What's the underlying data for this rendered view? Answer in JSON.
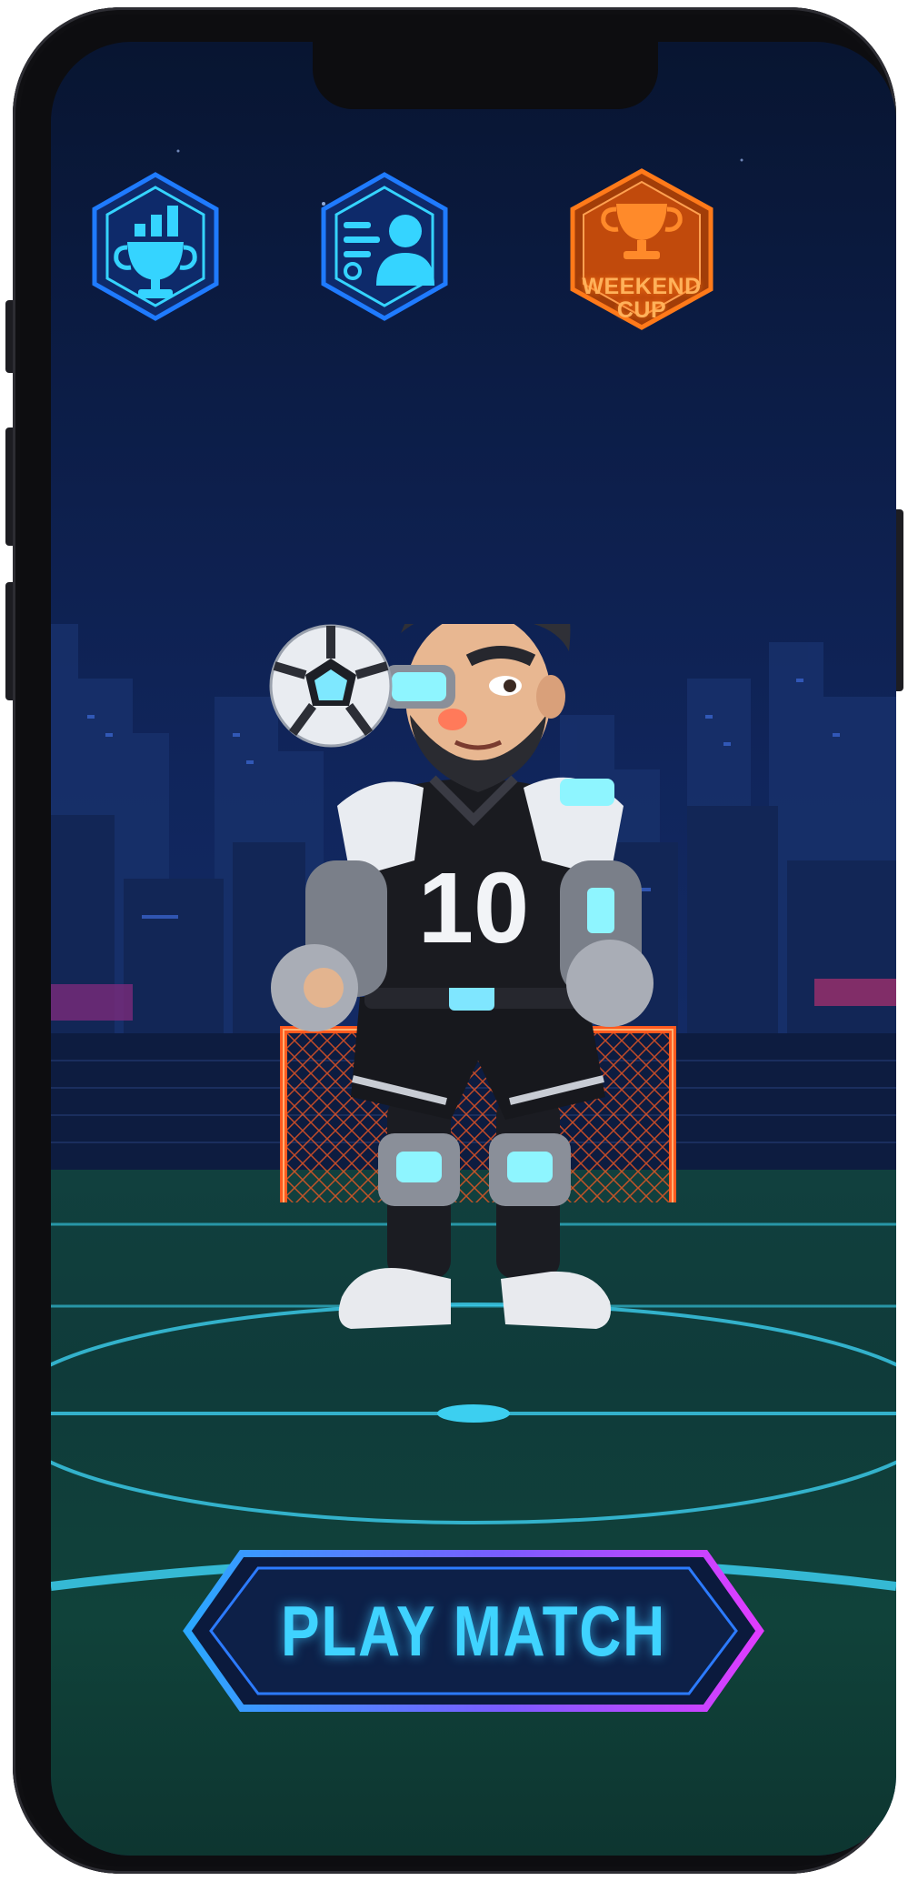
{
  "menu": {
    "leaderboard_icon": "trophy-bars-icon",
    "profile_icon": "player-profile-icon",
    "event_icon": "trophy-icon",
    "event_label_line1": "WEEKEND",
    "event_label_line2": "CUP"
  },
  "player": {
    "jersey_number": "10"
  },
  "actions": {
    "play_label": "PLAY MATCH"
  },
  "colors": {
    "accent_cyan": "#3fd3ff",
    "event_orange": "#ff7a1a",
    "button_magenta": "#d23cff",
    "goal_orange": "#ff5a1f"
  }
}
